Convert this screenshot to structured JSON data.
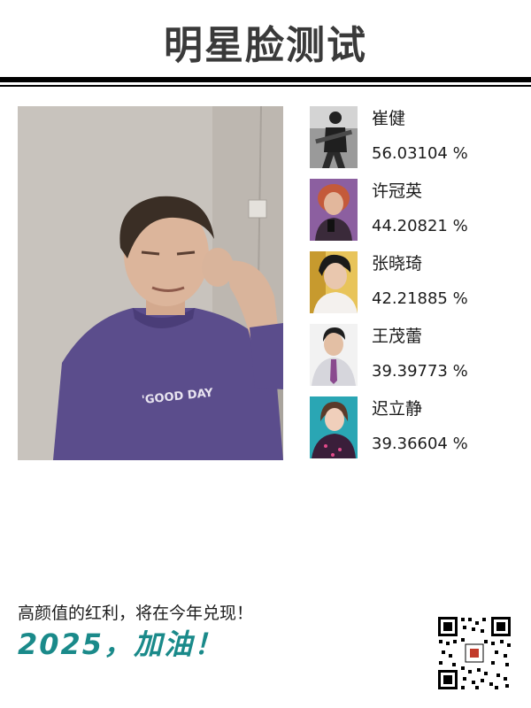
{
  "header": {
    "title": "明星脸测试"
  },
  "photo": {
    "shirt_text": "'GOOD DAY"
  },
  "results": [
    {
      "name": "崔健",
      "score": "56.03104 %"
    },
    {
      "name": "许冠英",
      "score": "44.20821 %"
    },
    {
      "name": "张晓琦",
      "score": "42.21885 %"
    },
    {
      "name": "王茂蕾",
      "score": "39.39773 %"
    },
    {
      "name": "迟立静",
      "score": "39.36604 %"
    }
  ],
  "footer": {
    "tagline": "高颜值的红利，将在今年兑现！",
    "slogan": "2025，加油！",
    "qr_icon": "qr-code-icon"
  },
  "colors": {
    "title": "#3a3a3a",
    "rule": "#000000",
    "slogan": "#1a8a8a",
    "text": "#1c1c1c"
  }
}
